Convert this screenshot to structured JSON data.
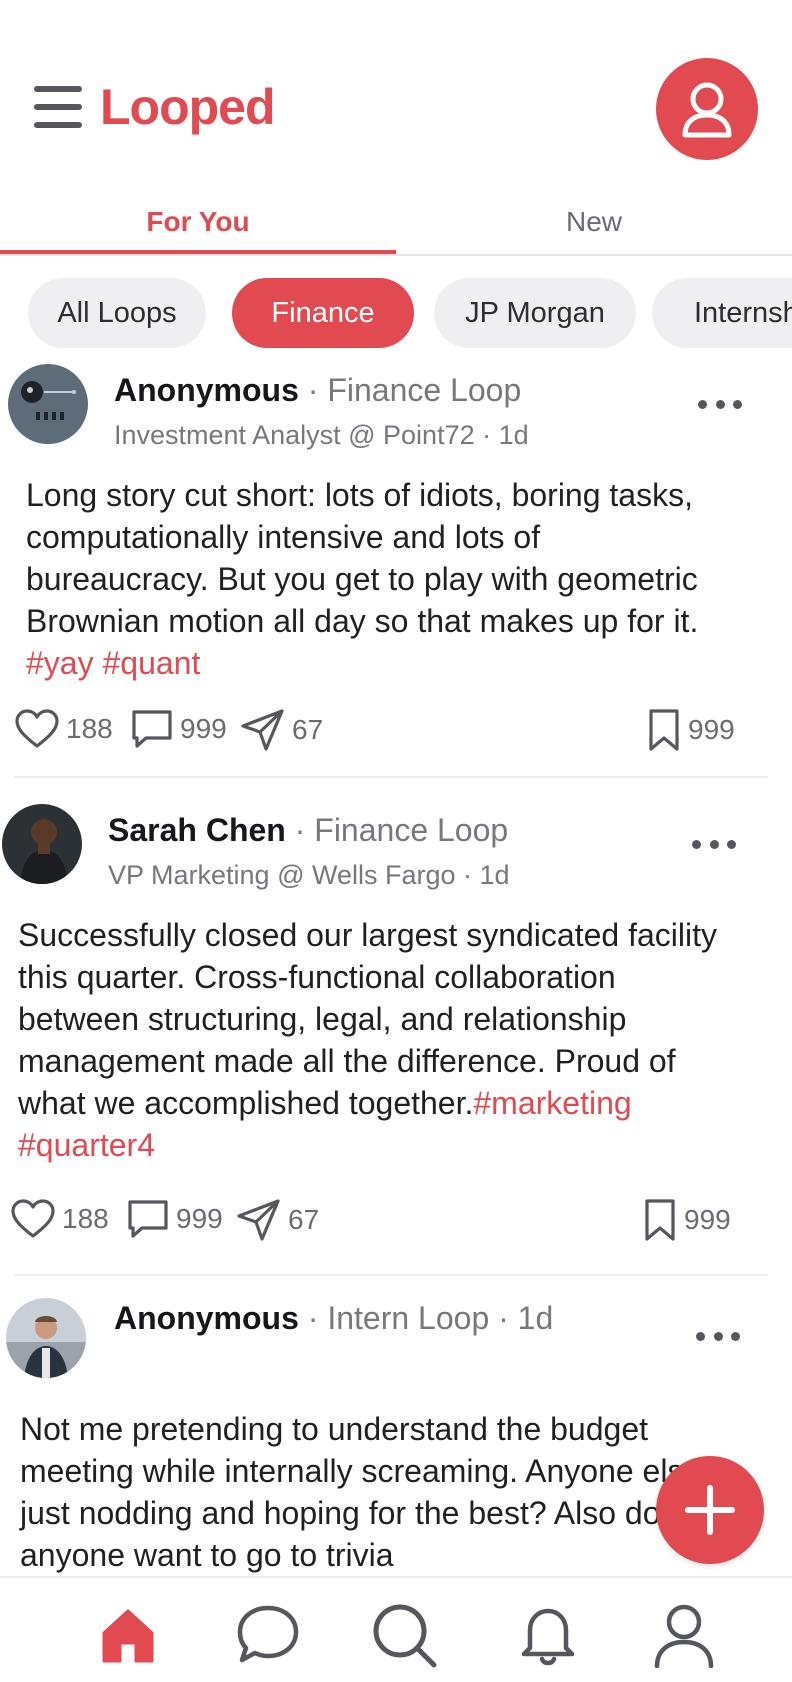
{
  "app": {
    "title": "Looped"
  },
  "colors": {
    "accent": "#e04a50",
    "text": "#1f1f24",
    "muted": "#77777f",
    "chip_bg": "#efeff1"
  },
  "header": {
    "brand": "Looped",
    "menu_icon": "hamburger-menu-icon",
    "profile_icon": "user-icon"
  },
  "tabs": [
    {
      "label": "For You",
      "active": true
    },
    {
      "label": "New",
      "active": false
    }
  ],
  "chips": [
    {
      "label": "All Loops",
      "selected": false
    },
    {
      "label": "Finance",
      "selected": true
    },
    {
      "label": "JP Morgan",
      "selected": false
    },
    {
      "label": "Internships",
      "selected": false
    }
  ],
  "posts": [
    {
      "author": "Anonymous",
      "meta": " · Finance Loop",
      "subtitle": "Investment Analyst @ Point72 · 1d",
      "body": "Long story cut short: lots of idiots, boring tasks, computationally intensive and lots of bureaucracy. But you get to play with geometric Brownian motion all day so that makes up for it. ",
      "hashtags": "#yay #quant",
      "likes": "188",
      "comments": "999",
      "shares": "67",
      "saves": "999"
    },
    {
      "author": "Sarah Chen",
      "meta": " · Finance Loop",
      "subtitle": "VP Marketing @ Wells Fargo · 1d",
      "body": "Successfully closed our largest syndicated facility this quarter. Cross-functional collaboration between structuring, legal, and relationship management made all the difference. Proud of what we accomplished together.",
      "hashtags": "#marketing #quarter4",
      "likes": "188",
      "comments": "999",
      "shares": "67",
      "saves": "999"
    },
    {
      "author": "Anonymous",
      "meta": " · Intern Loop · 1d",
      "body": "Not me pretending to understand the budget meeting while internally screaming. Anyone else just nodding and hoping for the best? Also does anyone want to go to trivia"
    }
  ],
  "bottom_nav": [
    {
      "icon": "home-icon",
      "active": true
    },
    {
      "icon": "chat-icon",
      "active": false
    },
    {
      "icon": "search-icon",
      "active": false
    },
    {
      "icon": "bell-icon",
      "active": false
    },
    {
      "icon": "profile-icon",
      "active": false
    }
  ]
}
